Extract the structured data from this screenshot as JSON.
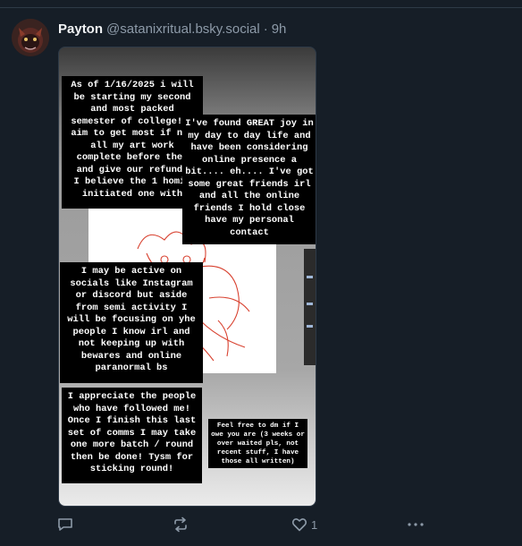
{
  "post": {
    "author_name": "Payton",
    "author_handle": "@satanixritual.bsky.social",
    "separator": "·",
    "time": "9h",
    "image": {
      "notes": [
        "As of 1/16/2025 i will\nbe starting my second\nand most packed\nsemester of college! I\naim to get most if not\nall my art work\ncomplete before then\nand give our refunds\nI believe the 1 homie\ninitiated one with",
        "I've found GREAT joy in\nmy day to day life and\nhave been considering\nonline presence a\nbit.... eh.... I've got\nsome great friends irl\nand all the online\nfriends I hold close\nhave my personal\ncontact",
        "I may be active on\nsocials like Instagram\nor discord but aside\nfrom semi activity I\nwill be focusing on yhe\npeople I know irl and\nnot keeping up with\nbewares and online\nparanormal bs",
        "I appreciate the people\nwho have followed me!\nOnce I finish this last\nset of comms I may take\none more batch / round\nthen be done! Tysm for\nsticking round!",
        "Feel free to dm if I\nowe you are (3 weeks or\nover waited pls, not\nrecent stuff, I have\nthose all written)"
      ]
    },
    "actions": {
      "reply_icon": "reply-icon",
      "repost_icon": "repost-icon",
      "like_icon": "heart-icon",
      "like_count": "1",
      "more_icon": "more-icon"
    }
  },
  "colors": {
    "background": "#161e27",
    "muted_text": "#8d9aa8",
    "icon": "#8d9aa8",
    "sketch_line": "#d8412f"
  }
}
